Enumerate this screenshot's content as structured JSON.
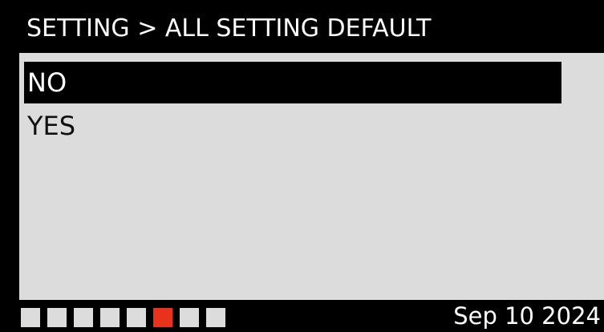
{
  "header": {
    "title": "SETTING > ALL SETTING DEFAULT"
  },
  "menu": {
    "items": [
      {
        "label": "NO",
        "selected": true
      },
      {
        "label": "YES",
        "selected": false
      }
    ]
  },
  "footer": {
    "page_count": 8,
    "active_page": 6,
    "date": "Sep 10 2024"
  },
  "colors": {
    "background": "#000000",
    "panel": "#dcdcdc",
    "selection": "#000000",
    "active_indicator": "#e8321e",
    "inactive_indicator": "#dcdcdc",
    "text_dark": "#111111",
    "text_light": "#ffffff"
  }
}
